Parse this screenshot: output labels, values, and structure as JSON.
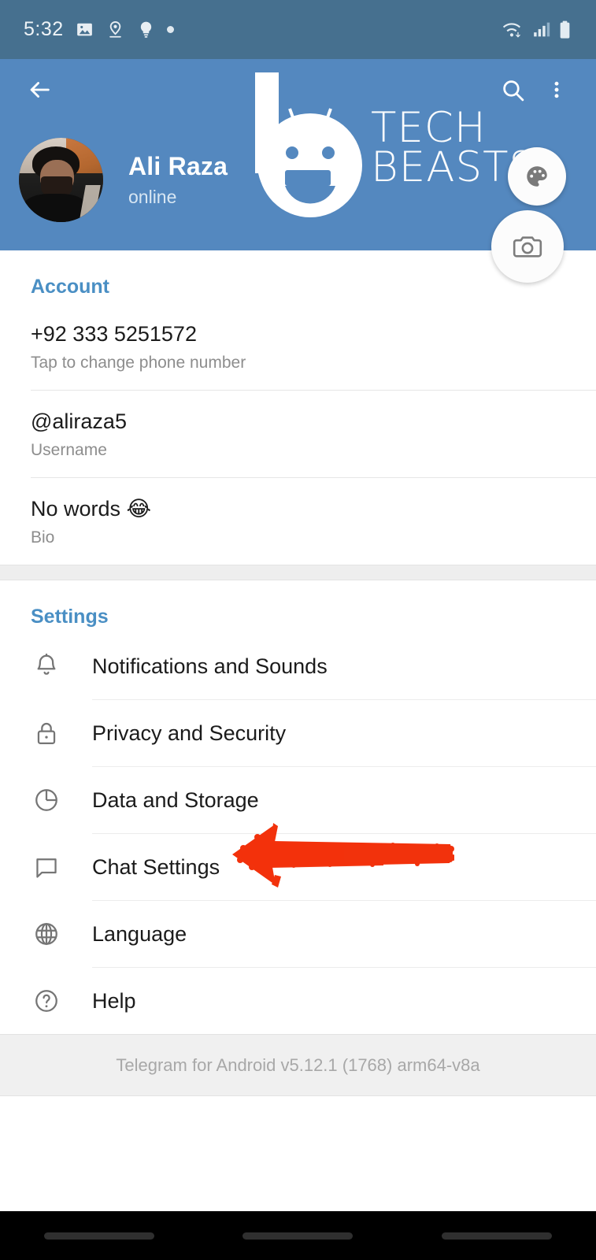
{
  "status_bar": {
    "time": "5:32",
    "left_icons": [
      "image-icon",
      "location-pin-icon",
      "lightbulb-icon",
      "dot-icon"
    ],
    "right_icons": [
      "wifi-icon",
      "cellular-signal-icon",
      "battery-icon"
    ],
    "background": "#46708f"
  },
  "header": {
    "background": "#5488bf",
    "back_icon": "back-arrow-icon",
    "search_icon": "search-icon",
    "overflow_icon": "overflow-menu-icon",
    "watermark": {
      "line1": "TECH",
      "line2": "BEASTS",
      "logo": "tech-beasts-robot-logo"
    },
    "profile": {
      "name": "Ali Raza",
      "status": "online",
      "avatar": "user-avatar-photo"
    },
    "fab_theme": "palette-icon",
    "fab_camera": "camera-icon"
  },
  "account": {
    "title": "Account",
    "rows": [
      {
        "value": "+92 333 5251572",
        "label": "Tap to change phone number"
      },
      {
        "value": "@aliraza5",
        "label": "Username"
      },
      {
        "value": "No words 😂",
        "label": "Bio"
      }
    ]
  },
  "settings": {
    "title": "Settings",
    "items": [
      {
        "label": "Notifications and Sounds",
        "icon": "bell-icon"
      },
      {
        "label": "Privacy and Security",
        "icon": "lock-icon"
      },
      {
        "label": "Data and Storage",
        "icon": "pie-chart-icon"
      },
      {
        "label": "Chat Settings",
        "icon": "speech-bubble-icon"
      },
      {
        "label": "Language",
        "icon": "globe-icon"
      },
      {
        "label": "Help",
        "icon": "question-circle-icon"
      }
    ]
  },
  "footer": {
    "version": "Telegram for Android v5.12.1 (1768) arm64-v8a"
  },
  "annotation": {
    "type": "red-arrow-pointing-left",
    "target": "Chat Settings",
    "color": "#f2320c"
  },
  "colors": {
    "accent": "#4a8fc4",
    "header": "#5488bf",
    "status_bar": "#46708f",
    "annotation": "#f2320c"
  }
}
